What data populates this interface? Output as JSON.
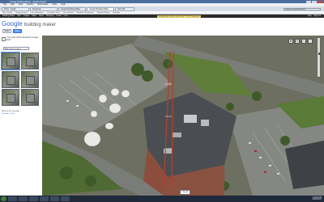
{
  "window": {
    "title": "Google Building Maker - Mozilla Firefox"
  },
  "menubar": [
    "File",
    "Edit",
    "View",
    "History",
    "Bookmarks",
    "Tools",
    "Help"
  ],
  "tabs": [
    {
      "label": "Inbox - Gmail"
    },
    {
      "label": "Facebook"
    },
    {
      "label": "Google Building Maker"
    },
    {
      "label": "Google Building Maker"
    },
    {
      "label": "New Tab"
    }
  ],
  "address_bar": "google.com/sketchup/bm/",
  "bookmarks": [
    "Most Visited",
    "Getting Started",
    "Latest Headlines",
    "Customize Links",
    "Free Hotmail",
    "Windows Marketplace",
    "Windows Media",
    "Windows"
  ],
  "page_header": {
    "links": [
      "Building Maker",
      "Web",
      "Images",
      "Maps",
      "News",
      "Shopping",
      "Gmail",
      "more"
    ],
    "right_links": [
      "Help",
      "Sign out"
    ],
    "banner": "Building Maker will be retired June 1, 2013. Read more"
  },
  "logo": {
    "google": "Google",
    "product": "building maker"
  },
  "editor_buttons": [
    "Editor",
    "Save"
  ],
  "hint": {
    "text": "Choose a building in the",
    "link": "Viewer",
    "rest": "to see the photos below"
  },
  "sidebar": {
    "note": "Your model will be checked for Google Earth",
    "dropdown": "Add another images",
    "address": "WSYX & WTTE studio",
    "address_link": "Columbus, Ohio"
  },
  "map": {
    "note": "Google"
  },
  "clock": {
    "time": "11:04 PM",
    "date": "3/25/2013"
  },
  "colors": {
    "accent": "#4d90fe",
    "taskbar": "#1f2a3a",
    "page_bar": "#2b2b2b"
  },
  "icons": [
    "pan-icon",
    "rotate-icon",
    "zoom-in-icon",
    "zoom-out-icon"
  ]
}
